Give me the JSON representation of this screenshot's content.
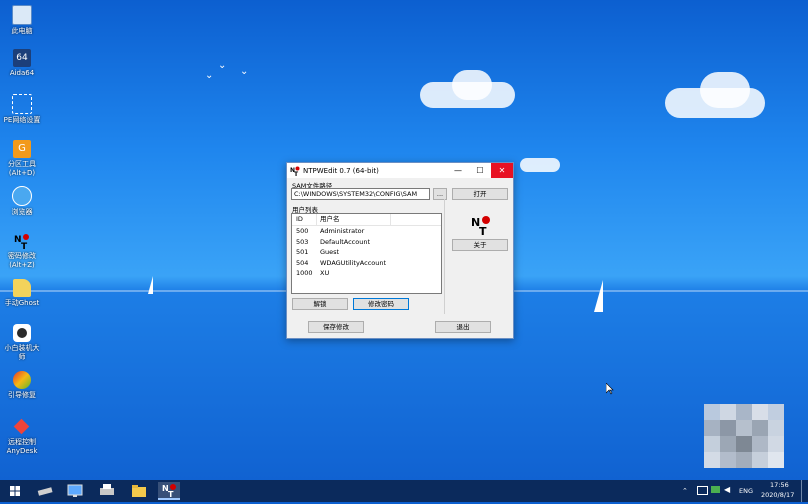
{
  "desktop_icons": [
    {
      "label": "此电脑",
      "icon": "computer-icon"
    },
    {
      "label": "Aida64",
      "icon": "aida64-icon"
    },
    {
      "label": "PE网络设置",
      "icon": "network-icon"
    },
    {
      "label": "分区工具\n(Alt+D)",
      "icon": "diskgenius-icon"
    },
    {
      "label": "浏览器",
      "icon": "browser-icon"
    },
    {
      "label": "密码修改\n(Alt+Z)",
      "icon": "ntpwedit-icon"
    },
    {
      "label": "手动Ghost",
      "icon": "ghost-icon"
    },
    {
      "label": "小白装机大\n师",
      "icon": "xiaobai-icon"
    },
    {
      "label": "引导修复",
      "icon": "boot-repair-icon"
    },
    {
      "label": "远程控制\nAnyDesk",
      "icon": "anydesk-icon"
    }
  ],
  "window": {
    "title": "NTPWEdit 0.7 (64-bit)",
    "sam_label": "SAM文件路径",
    "sam_path": "C:\\WINDOWS\\SYSTEM32\\CONFIG\\SAM",
    "browse_label": "...",
    "open_label": "打开",
    "users_label": "用户列表",
    "col_id": "ID",
    "col_user": "用户名",
    "users": [
      {
        "id": "500",
        "name": "Administrator"
      },
      {
        "id": "503",
        "name": "DefaultAccount"
      },
      {
        "id": "501",
        "name": "Guest"
      },
      {
        "id": "504",
        "name": "WDAGUtilityAccount"
      },
      {
        "id": "1000",
        "name": "XU"
      }
    ],
    "unlock_label": "解锁",
    "change_pw_label": "修改密码",
    "about_label": "关于",
    "save_label": "保存修改",
    "exit_label": "退出"
  },
  "taskbar": {
    "time": "17:56",
    "date": "2020/8/17",
    "lang": "ENG"
  },
  "colors": {
    "accent": "#0078d7",
    "close": "#e81123",
    "taskbar": "#0b2a5c"
  }
}
